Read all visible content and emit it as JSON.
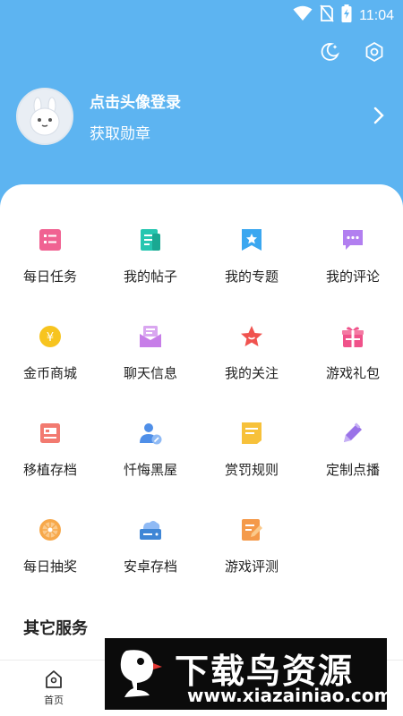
{
  "status_bar": {
    "time": "11:04"
  },
  "profile": {
    "title": "点击头像登录",
    "subtitle": "获取勋章"
  },
  "grid": [
    {
      "label": "每日任务",
      "icon": "task-list-icon",
      "color": "#f06292"
    },
    {
      "label": "我的帖子",
      "icon": "document-icon",
      "color": "#26c6b0"
    },
    {
      "label": "我的专题",
      "icon": "bookmark-star-icon",
      "color": "#3ba7f0"
    },
    {
      "label": "我的评论",
      "icon": "chat-bubble-icon",
      "color": "#b27ff0"
    },
    {
      "label": "金币商城",
      "icon": "coin-icon",
      "color": "#f7c41f"
    },
    {
      "label": "聊天信息",
      "icon": "envelope-icon",
      "color": "#c77ee8"
    },
    {
      "label": "我的关注",
      "icon": "star-icon",
      "color": "#f0534f"
    },
    {
      "label": "游戏礼包",
      "icon": "gift-icon",
      "color": "#f0528a"
    },
    {
      "label": "移植存档",
      "icon": "archive-box-icon",
      "color": "#f27a70"
    },
    {
      "label": "忏悔黑屋",
      "icon": "user-edit-icon",
      "color": "#4f8fe8"
    },
    {
      "label": "赏罚规则",
      "icon": "rules-card-icon",
      "color": "#f7c13a"
    },
    {
      "label": "定制点播",
      "icon": "pencil-icon",
      "color": "#9a72e8"
    },
    {
      "label": "每日抽奖",
      "icon": "lottery-wheel-icon",
      "color": "#f7a84a"
    },
    {
      "label": "安卓存档",
      "icon": "cloud-drive-icon",
      "color": "#3f86d6"
    },
    {
      "label": "游戏评测",
      "icon": "review-note-icon",
      "color": "#f49a4a"
    }
  ],
  "section": {
    "other_services": "其它服务"
  },
  "bottom_nav": {
    "home": "首页"
  },
  "watermark": {
    "title": "下载鸟资源",
    "url": "www.xiazainiao.com"
  }
}
